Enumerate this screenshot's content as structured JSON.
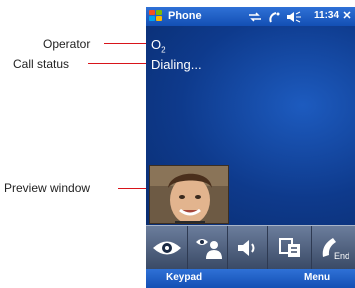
{
  "callouts": {
    "operator": "Operator",
    "call_status": "Call status",
    "preview_window": "Preview window"
  },
  "title_bar": {
    "title": "Phone",
    "time": "11:34",
    "close": "✕"
  },
  "call": {
    "operator": "O",
    "operator_sub": "2",
    "status": "Dialing..."
  },
  "softkeys": {
    "left": "Keypad",
    "right": "Menu"
  },
  "toolbar": {
    "end_label": "End"
  }
}
